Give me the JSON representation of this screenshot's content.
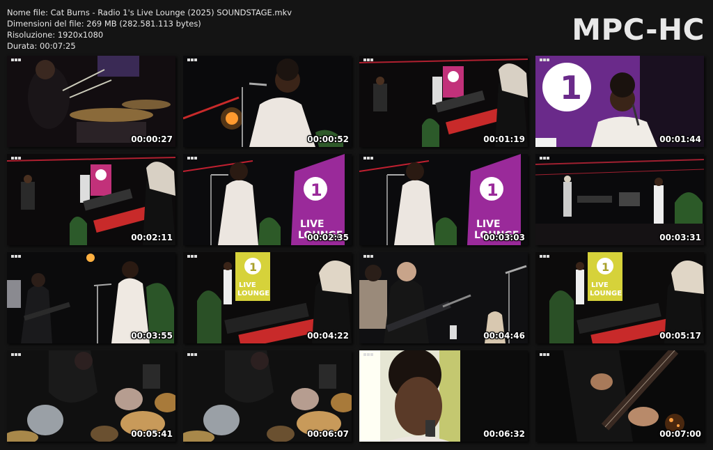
{
  "file_info": {
    "name_line": "Nome file: Cat Burns - Radio 1's Live Lounge (2025) SOUNDSTAGE.mkv",
    "size_line": "Dimensioni del file: 269 MB (282.581.113 bytes)",
    "resolution_line": "Risoluzione: 1920x1080",
    "duration_line": "Durata: 00:07:25"
  },
  "logo_text": "MPC-HC",
  "thumbnails": [
    {
      "time": "00:00:27",
      "scene": "drummer-closeup"
    },
    {
      "time": "00:00:52",
      "scene": "singer-white-suit-mic"
    },
    {
      "time": "00:01:19",
      "scene": "band-wide-keyboard"
    },
    {
      "time": "00:01:44",
      "scene": "singer-radio1-screen"
    },
    {
      "time": "00:02:11",
      "scene": "band-wide-keyboard"
    },
    {
      "time": "00:02:35",
      "scene": "singer-live-lounge-screen"
    },
    {
      "time": "00:03:03",
      "scene": "singer-live-lounge-screen"
    },
    {
      "time": "00:03:31",
      "scene": "stage-wide"
    },
    {
      "time": "00:03:55",
      "scene": "guitarist-and-singer"
    },
    {
      "time": "00:04:22",
      "scene": "keyboardist-live-lounge"
    },
    {
      "time": "00:04:46",
      "scene": "guitarist-closeup"
    },
    {
      "time": "00:05:17",
      "scene": "keyboardist-live-lounge"
    },
    {
      "time": "00:05:41",
      "scene": "drummer-overhead"
    },
    {
      "time": "00:06:07",
      "scene": "drummer-overhead"
    },
    {
      "time": "00:06:32",
      "scene": "singer-face-closeup"
    },
    {
      "time": "00:07:00",
      "scene": "bass-closeup"
    }
  ]
}
